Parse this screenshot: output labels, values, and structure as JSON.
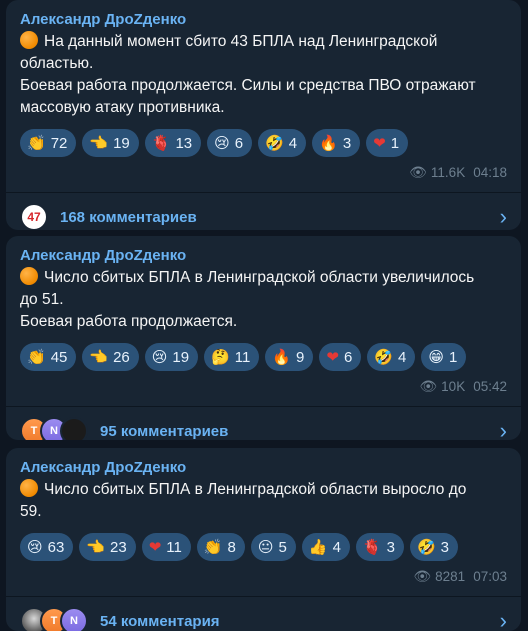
{
  "posts": [
    {
      "author": "Александр ДроZденко",
      "lines": [
        "На данный момент сбито 43 БПЛА над Ленинградской",
        "областью.",
        "Боевая работа продолжается. Силы и средства ПВО отражают",
        "массовую атаку противника."
      ],
      "reactions": [
        {
          "icon": "clapping-hands-icon",
          "emoji": "👏",
          "count": "72"
        },
        {
          "icon": "pointing-hand-icon",
          "emoji": "👈",
          "count": "19"
        },
        {
          "icon": "anatomical-heart-icon",
          "emoji": "🫀",
          "count": "13"
        },
        {
          "icon": "crying-face-icon",
          "emoji": "😢",
          "count": "6"
        },
        {
          "icon": "rofl-face-icon",
          "emoji": "🤣",
          "count": "4"
        },
        {
          "icon": "fire-icon",
          "emoji": "🔥",
          "count": "3"
        },
        {
          "icon": "heart-icon",
          "emoji": "❤",
          "count": "1"
        }
      ],
      "views": "11.6K",
      "time": "04:18",
      "comments_label": "168 комментариев",
      "avatars": [
        {
          "type": "logo",
          "text": "47"
        }
      ]
    },
    {
      "author": "Александр ДроZденко",
      "lines": [
        "Число сбитых БПЛА в Ленинградской области увеличилось",
        "до 51.",
        "Боевая работа продолжается."
      ],
      "reactions": [
        {
          "icon": "clapping-hands-icon",
          "emoji": "👏",
          "count": "45"
        },
        {
          "icon": "pointing-hand-icon",
          "emoji": "👈",
          "count": "26"
        },
        {
          "icon": "crying-face-icon",
          "emoji": "😢",
          "count": "19"
        },
        {
          "icon": "thinking-face-icon",
          "emoji": "🤔",
          "count": "11"
        },
        {
          "icon": "fire-icon",
          "emoji": "🔥",
          "count": "9"
        },
        {
          "icon": "heart-icon",
          "emoji": "❤",
          "count": "6"
        },
        {
          "icon": "rofl-face-icon",
          "emoji": "🤣",
          "count": "4"
        },
        {
          "icon": "grinning-face-icon",
          "emoji": "😁",
          "count": "1"
        }
      ],
      "views": "10K",
      "time": "05:42",
      "comments_label": "95 комментариев",
      "avatars": [
        {
          "type": "t",
          "text": "T"
        },
        {
          "type": "n",
          "text": "N"
        },
        {
          "type": "dark",
          "text": ""
        }
      ]
    },
    {
      "author": "Александр ДроZденко",
      "lines": [
        "Число сбитых БПЛА в Ленинградской области выросло до",
        "59."
      ],
      "reactions": [
        {
          "icon": "crying-face-icon",
          "emoji": "😢",
          "count": "63"
        },
        {
          "icon": "pointing-hand-icon",
          "emoji": "👈",
          "count": "23"
        },
        {
          "icon": "heart-icon",
          "emoji": "❤",
          "count": "11"
        },
        {
          "icon": "clapping-hands-icon",
          "emoji": "👏",
          "count": "8"
        },
        {
          "icon": "neutral-face-icon",
          "emoji": "😐",
          "count": "5"
        },
        {
          "icon": "thumbs-up-icon",
          "emoji": "👍",
          "count": "4"
        },
        {
          "icon": "anatomical-heart-icon",
          "emoji": "🫀",
          "count": "3"
        },
        {
          "icon": "rofl-face-icon",
          "emoji": "🤣",
          "count": "3"
        }
      ],
      "views": "8281",
      "time": "07:03",
      "comments_label": "54 комментария",
      "avatars": [
        {
          "type": "photo",
          "text": ""
        },
        {
          "type": "t",
          "text": "T"
        },
        {
          "type": "n",
          "text": "N"
        }
      ]
    }
  ],
  "colors": {
    "background": "#0e1621",
    "bubble": "#182533",
    "accent": "#6ab3f3",
    "reaction_pill": "#2b5278",
    "meta": "#6d7f8f"
  }
}
